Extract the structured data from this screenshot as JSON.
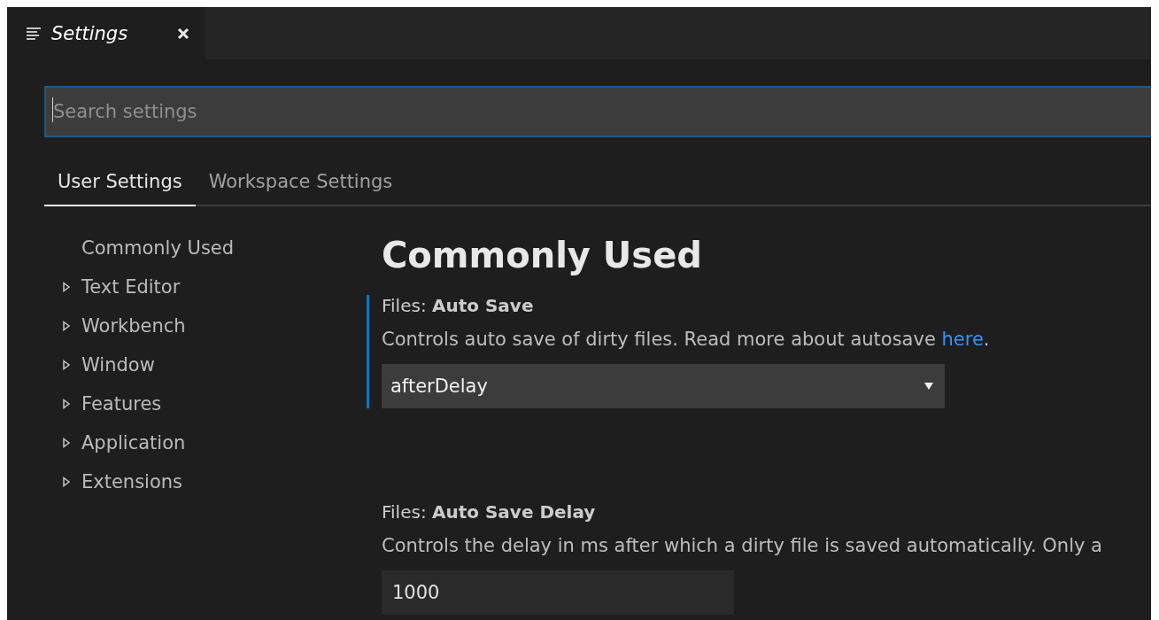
{
  "editor_tab": {
    "title": "Settings",
    "selected": true
  },
  "search": {
    "placeholder": "Search settings"
  },
  "scope_tabs": [
    {
      "label": "User Settings",
      "selected": true
    },
    {
      "label": "Workspace Settings",
      "selected": false
    }
  ],
  "sidebar": {
    "items": [
      {
        "label": "Commonly Used",
        "kind": "leaf"
      },
      {
        "label": "Text Editor",
        "kind": "group",
        "expanded": false
      },
      {
        "label": "Workbench",
        "kind": "group",
        "expanded": false
      },
      {
        "label": "Window",
        "kind": "group",
        "expanded": false
      },
      {
        "label": "Features",
        "kind": "group",
        "expanded": false
      },
      {
        "label": "Application",
        "kind": "group",
        "expanded": false
      },
      {
        "label": "Extensions",
        "kind": "group",
        "expanded": false
      }
    ]
  },
  "section_title": "Commonly Used",
  "settings": [
    {
      "title": "Files: **Auto Save**",
      "description": "Controls auto save of dirty files. Read more about autosave ",
      "link": "here",
      "after_link": ".",
      "kind": "dropdown",
      "value": "afterDelay",
      "focused": true
    },
    {
      "title": "Files: **Auto Save Delay**",
      "description": "Controls the delay in ms after which a dirty file is saved automatically. Only a",
      "kind": "number",
      "value": "1000",
      "focused": false
    }
  ]
}
